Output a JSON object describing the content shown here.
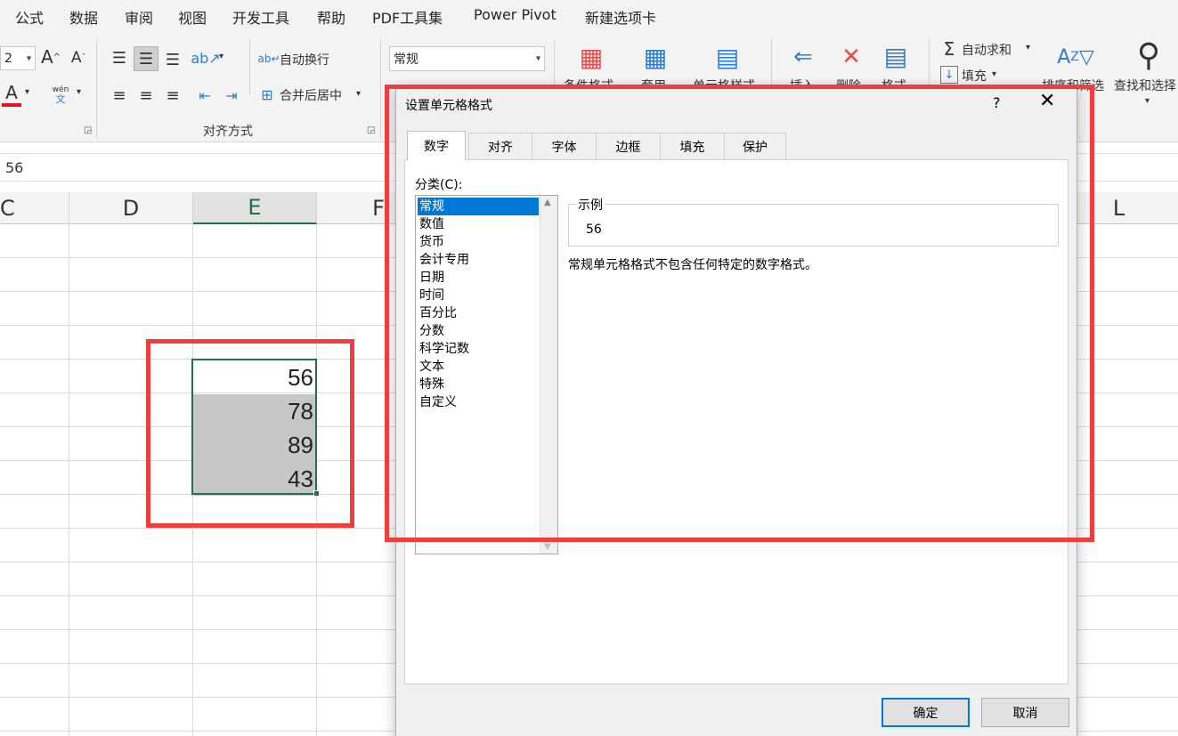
{
  "menu": {
    "items": [
      "公式",
      "数据",
      "审阅",
      "视图",
      "开发工具",
      "帮助",
      "PDF工具集",
      "Power Pivot",
      "新建选项卡"
    ]
  },
  "ribbon": {
    "font_size": "2",
    "wrap_text": "自动换行",
    "merge_center": "合并后居中",
    "alignment_group": "对齐方式",
    "number_format": "常规",
    "conditional_format": "条件格式",
    "table_format": "套用",
    "cell_styles": "单元格样式",
    "insert": "插入",
    "delete": "删除",
    "format": "格式",
    "autosum": "自动求和",
    "fill": "填充",
    "sort_filter": "排序和筛选",
    "find_select": "查找和选择",
    "pinyin": "wén",
    "pinyin_char": "文"
  },
  "formula_bar": {
    "value": "56"
  },
  "columns": [
    "C",
    "D",
    "E",
    "F",
    "L"
  ],
  "cells": [
    "56",
    "78",
    "89",
    "43"
  ],
  "dialog": {
    "title": "设置单元格格式",
    "help": "?",
    "tabs": [
      "数字",
      "对齐",
      "字体",
      "边框",
      "填充",
      "保护"
    ],
    "category_label": "分类(C):",
    "categories": [
      "常规",
      "数值",
      "货币",
      "会计专用",
      "日期",
      "时间",
      "百分比",
      "分数",
      "科学记数",
      "文本",
      "特殊",
      "自定义"
    ],
    "sample_label": "示例",
    "sample_value": "56",
    "description": "常规单元格格式不包含任何特定的数字格式。",
    "ok": "确定",
    "cancel": "取消"
  },
  "colors": {
    "excel_green": "#217346",
    "highlight_red": "#f03e3e",
    "selection_blue": "#0078d7",
    "shaded_cell": "#c6c6c6"
  }
}
